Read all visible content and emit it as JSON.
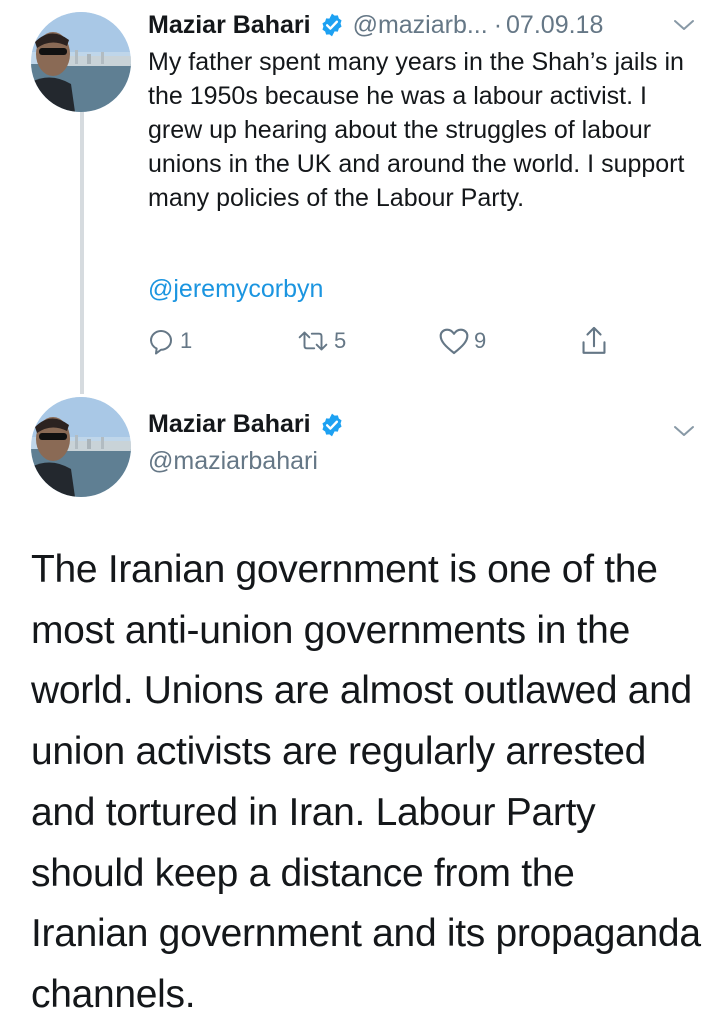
{
  "reply_tweet": {
    "display_name": "Maziar Bahari",
    "handle": "@maziarb...",
    "separator": "·",
    "date": "07.09.18",
    "text": "My father spent many years in the Shah’s jails in the 1950s because he was a labour activist. I grew up hearing about the struggles of labour unions in the UK and around the world. I support many policies of the Labour Party.",
    "mention": "@jeremycorbyn",
    "actions": {
      "reply_count": "1",
      "retweet_count": "5",
      "like_count": "9"
    }
  },
  "main_tweet": {
    "display_name": "Maziar Bahari",
    "handle": "@maziarbahari",
    "text": "The Iranian government is one of the most anti-union governments in the world. Unions are almost outlawed and union activists are regularly arrested and tortured in Iran. Labour Party should keep a distance from the Iranian government and its propaganda channels."
  },
  "icons": {
    "verified": "verified-badge-icon",
    "more": "chevron-down-icon",
    "reply": "reply-icon",
    "retweet": "retweet-icon",
    "like": "heart-icon",
    "share": "share-icon"
  },
  "colors": {
    "verified_blue": "#1da1f2",
    "link_blue": "#1b95e0",
    "secondary_text": "#657786",
    "thread_line": "#d6dbdf"
  }
}
